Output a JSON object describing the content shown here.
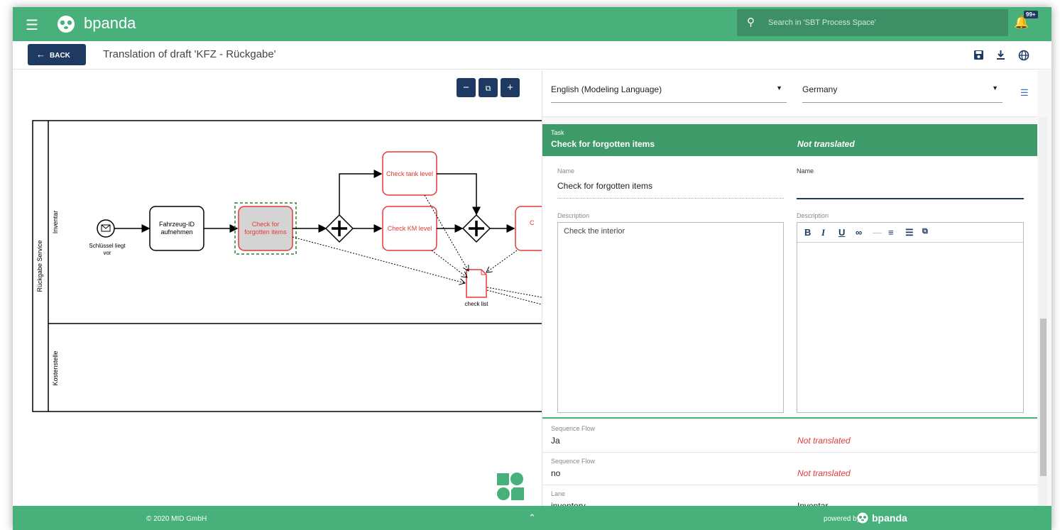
{
  "app": {
    "brand": "bpanda",
    "menu_icon": "menu-icon",
    "logo_icon": "panda-logo-icon"
  },
  "search": {
    "placeholder": "Search in 'SBT Process Space'"
  },
  "notifications": {
    "badge": "99+"
  },
  "toolbar": {
    "back_label": "BACK",
    "title": "Translation of draft 'KFZ - Rückgabe'"
  },
  "diagram": {
    "pool": "Rückgabe Service",
    "lanes": [
      "Inventar",
      "Kostenstelle"
    ],
    "start_event": "Schlüssel liegt vor",
    "tasks": {
      "fahrzeug": "Fahrzeug-ID aufnehmen",
      "forgotten": "Check for forgotten items",
      "tank": "Check tank level",
      "km": "Check KM level"
    },
    "data_object": "check list",
    "colors": {
      "highlight": "#e53935",
      "selected_fill": "#d4d4d4",
      "selection": "#2e7d32"
    }
  },
  "languages": {
    "source": "English  (Modeling Language)",
    "target": "Germany"
  },
  "task_card": {
    "type": "Task",
    "name": "Check for forgotten items",
    "status": "Not translated",
    "name_label": "Name",
    "source_name": "Check for forgotten items",
    "target_name_label": "Name",
    "target_name_value": "",
    "description_label": "Description",
    "source_description": "Check the interior",
    "target_description_label": "Description"
  },
  "elements": [
    {
      "type": "Sequence Flow",
      "source": "Ja",
      "target": "Not translated",
      "translated": false
    },
    {
      "type": "Sequence Flow",
      "source": "no",
      "target": "Not translated",
      "translated": false
    },
    {
      "type": "Lane",
      "source": "inventory",
      "target": "Inventar",
      "translated": true
    }
  ],
  "footer": {
    "copyright": "© 2020 MID GmbH",
    "powered_by": "powered by",
    "brand": "bpanda"
  }
}
